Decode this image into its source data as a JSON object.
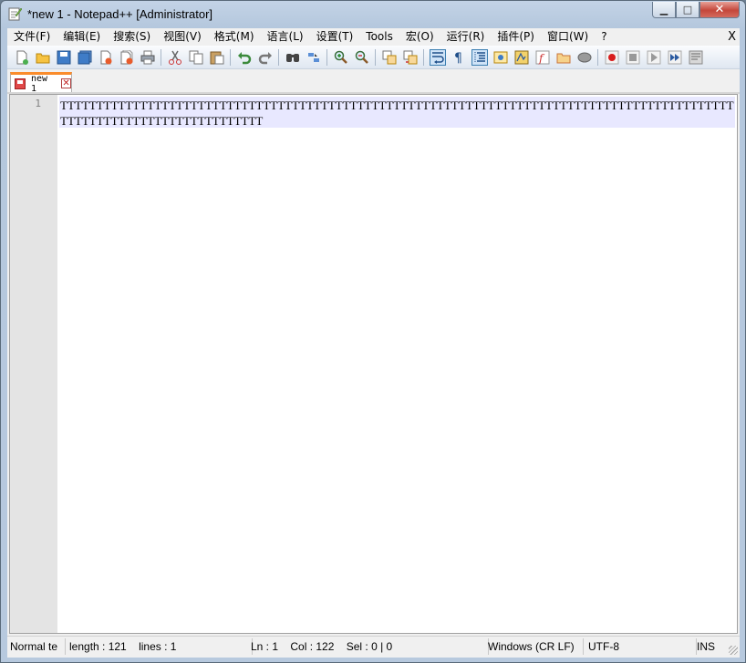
{
  "window": {
    "title": "*new 1 - Notepad++ [Administrator]"
  },
  "caption_buttons": {
    "minimize": "▁",
    "maximize": "□",
    "close": "✕"
  },
  "menu": {
    "items": [
      "文件(F)",
      "编辑(E)",
      "搜索(S)",
      "视图(V)",
      "格式(M)",
      "语言(L)",
      "设置(T)",
      "Tools",
      "宏(O)",
      "运行(R)",
      "插件(P)",
      "窗口(W)",
      "?"
    ],
    "close_label": "X"
  },
  "toolbar": {
    "icons": [
      "new-file-icon",
      "open-file-icon",
      "save-icon",
      "save-all-icon",
      "close-icon",
      "close-all-icon",
      "print-icon",
      "cut-icon",
      "copy-icon",
      "paste-icon",
      "undo-icon",
      "redo-icon",
      "find-icon",
      "replace-icon",
      "zoom-in-icon",
      "zoom-out-icon",
      "sync-vertical-icon",
      "sync-horizontal-icon",
      "word-wrap-icon",
      "show-all-chars-icon",
      "indent-guide-icon",
      "udl-icon",
      "doc-map-icon",
      "function-list-icon",
      "folder-workspace-icon",
      "monitor-icon",
      "record-macro-icon",
      "stop-macro-icon",
      "play-macro-icon",
      "run-macro-multiple-icon",
      "save-macro-icon"
    ]
  },
  "tab": {
    "label": "new 1",
    "close": "✕"
  },
  "editor": {
    "line_number": "1",
    "content": "TTTTTTTTTTTTTTTTTTTTTTTTTTTTTTTTTTTTTTTTTTTTTTTTTTTTTTTTTTTTTTTTTTTTTTTTTTTTTTTTTTTTTTTTTTTTTTTTTTTTTTTTTTTTTTTTTTTTTTTTT"
  },
  "status": {
    "doc_type": "Normal te",
    "length": "length : 121",
    "lines": "lines : 1",
    "ln": "Ln : 1",
    "col": "Col : 122",
    "sel": "Sel : 0 | 0",
    "eol": "Windows (CR LF)",
    "encoding": "UTF-8",
    "mode": "INS"
  },
  "colors": {
    "tab_accent": "#fa8c2c",
    "current_line": "#e8e8ff",
    "gutter": "#e4e4e4"
  }
}
